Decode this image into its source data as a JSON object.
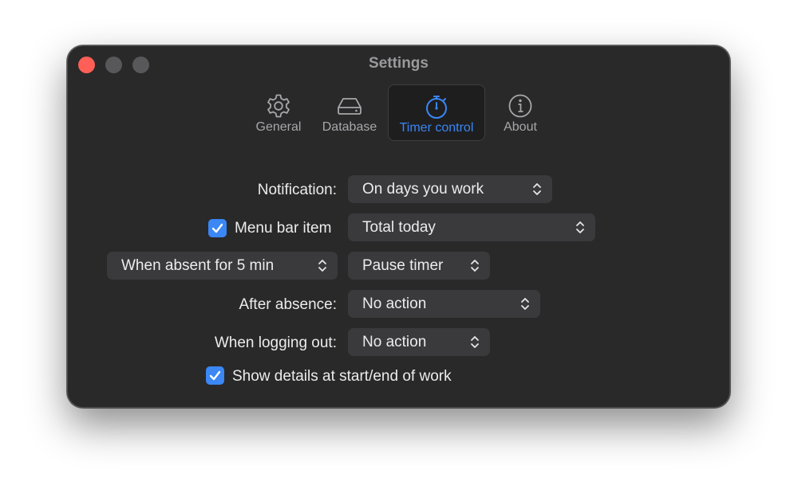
{
  "window": {
    "title": "Settings"
  },
  "tabs": [
    {
      "label": "General",
      "icon": "gear-icon"
    },
    {
      "label": "Database",
      "icon": "drive-icon"
    },
    {
      "label": "Timer control",
      "icon": "stopwatch-icon",
      "active": true
    },
    {
      "label": "About",
      "icon": "info-icon"
    }
  ],
  "settings": {
    "notification": {
      "label": "Notification:",
      "value": "On days you work"
    },
    "menu_bar_item": {
      "label": "Menu bar item",
      "checked": true,
      "value": "Total today"
    },
    "absence_rule": {
      "trigger": "When absent for 5 min",
      "action": "Pause timer"
    },
    "after_absence": {
      "label": "After absence:",
      "value": "No action"
    },
    "logging_out": {
      "label": "When logging out:",
      "value": "No action"
    },
    "show_details": {
      "label": "Show details at start/end of work",
      "checked": true
    }
  },
  "colors": {
    "accent": "#3a87f5",
    "window_bg": "#29292a",
    "control_bg": "#3a3a3c",
    "close": "#ff5f57"
  }
}
